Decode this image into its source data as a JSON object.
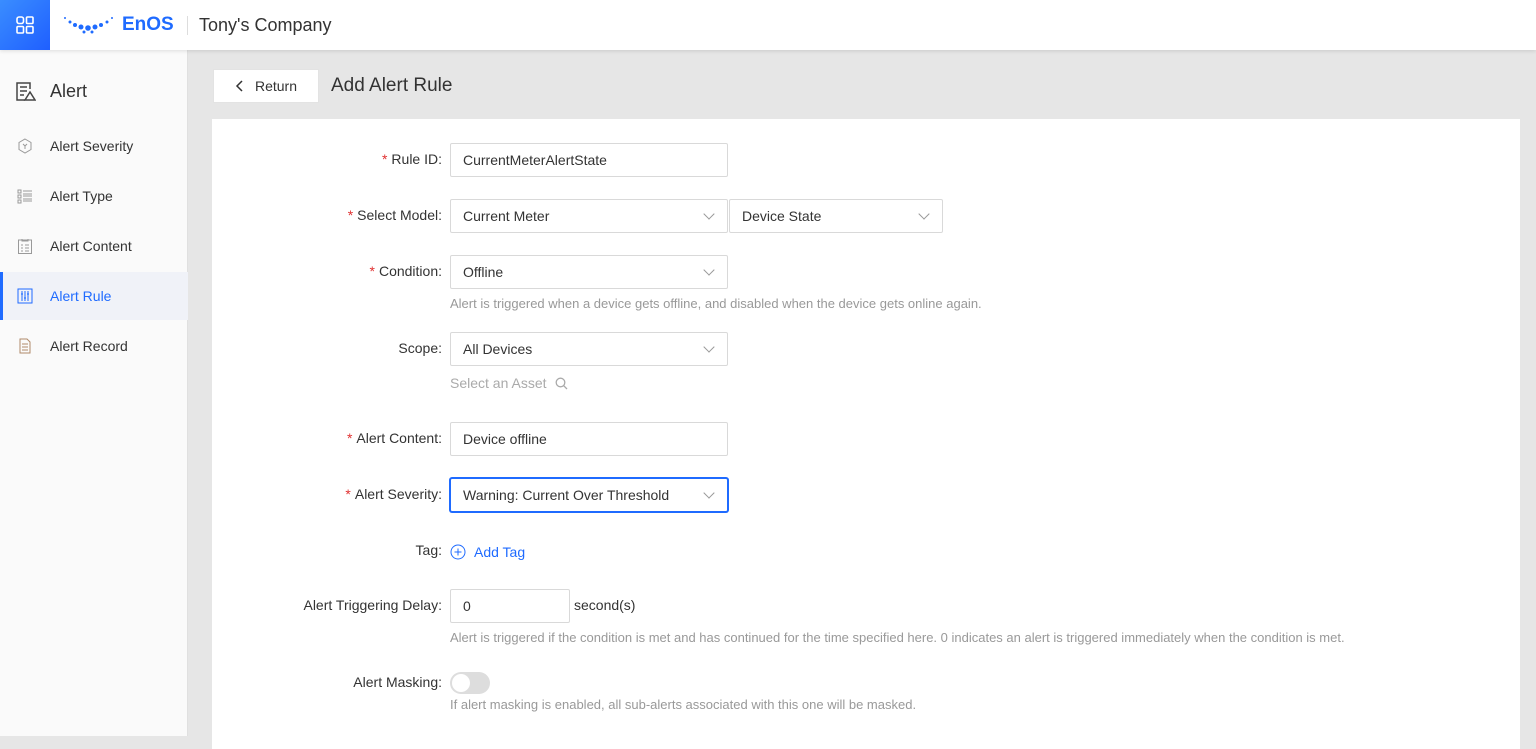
{
  "header": {
    "brand": "EnOS",
    "company": "Tony's Company"
  },
  "sidebar": {
    "title": "Alert",
    "items": [
      {
        "label": "Alert Severity",
        "icon": "hexagon-icon"
      },
      {
        "label": "Alert Type",
        "icon": "list-icon"
      },
      {
        "label": "Alert Content",
        "icon": "clipboard-icon"
      },
      {
        "label": "Alert Rule",
        "icon": "sliders-icon",
        "active": true
      },
      {
        "label": "Alert Record",
        "icon": "document-icon"
      }
    ]
  },
  "page": {
    "return_label": "Return",
    "title": "Add Alert Rule"
  },
  "form": {
    "rule_id": {
      "label": "Rule ID",
      "value": "CurrentMeterAlertState"
    },
    "model": {
      "label": "Select Model",
      "value": "Current Meter",
      "value2": "Device State"
    },
    "condition": {
      "label": "Condition",
      "value": "Offline",
      "help": "Alert is triggered when a device gets offline, and disabled when the device gets online again."
    },
    "scope": {
      "label": "Scope",
      "value": "All Devices",
      "asset_placeholder": "Select an Asset"
    },
    "content": {
      "label": "Alert Content",
      "value": "Device offline"
    },
    "severity": {
      "label": "Alert Severity",
      "value": "Warning: Current Over Threshold"
    },
    "tag": {
      "label": "Tag",
      "add_label": "Add Tag"
    },
    "delay": {
      "label": "Alert Triggering Delay",
      "value": "0",
      "unit": "second(s)",
      "help": "Alert is triggered if the condition is met and has continued for the time specified here. 0 indicates an alert is triggered immediately when the condition is met."
    },
    "masking": {
      "label": "Alert Masking",
      "enabled": false,
      "help": "If alert masking is enabled, all sub-alerts associated with this one will be masked."
    }
  },
  "colors": {
    "accent": "#1f6bff",
    "required": "#e03030"
  }
}
